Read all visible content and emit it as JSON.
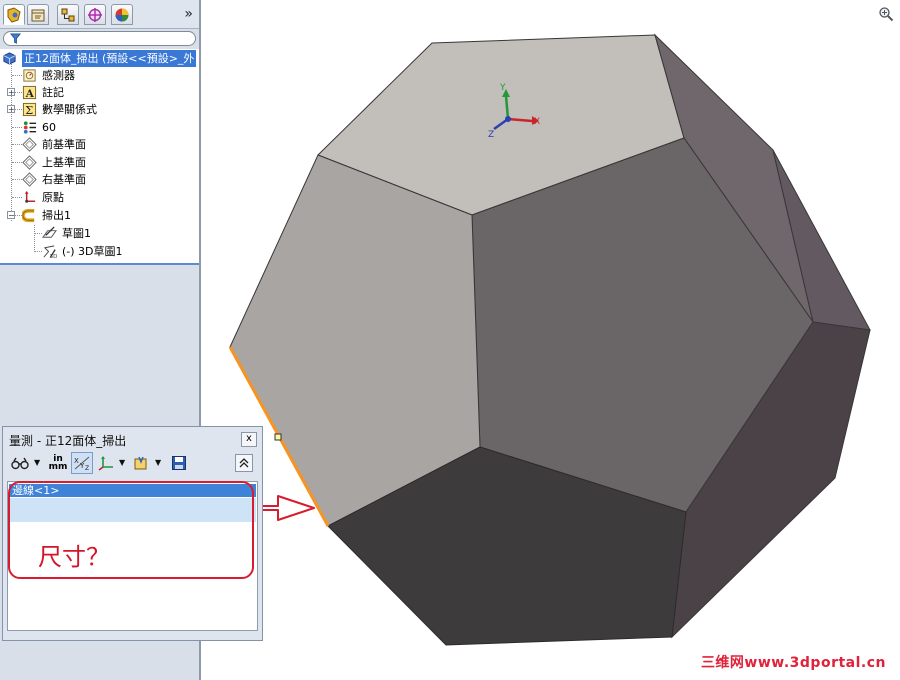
{
  "feature_tree": {
    "root_label": "正12面体_掃出 (預設<<預設>_外",
    "items": [
      {
        "label": "感測器",
        "icon": "sensor-icon"
      },
      {
        "label": "註記",
        "icon": "annotation-icon"
      },
      {
        "label": "數學關係式",
        "icon": "equation-icon"
      },
      {
        "label": "60",
        "icon": "design-table-icon"
      },
      {
        "label": "前基準面",
        "icon": "plane-icon"
      },
      {
        "label": "上基準面",
        "icon": "plane-icon"
      },
      {
        "label": "右基準面",
        "icon": "plane-icon"
      },
      {
        "label": "原點",
        "icon": "origin-icon"
      },
      {
        "label": "掃出1",
        "icon": "sweep-icon"
      },
      {
        "label": "草圖1",
        "icon": "sketch-icon"
      },
      {
        "label": "(-) 3D草圖1",
        "icon": "3d-sketch-icon"
      }
    ]
  },
  "measure_dialog": {
    "title": "量測 - 正12面体_掃出",
    "close_label": "x",
    "units_label_top": "in",
    "units_label_bottom": "mm",
    "selection_item": "邊線<1>"
  },
  "annotation": {
    "text": "尺寸？"
  },
  "triad": {
    "x_label": "X",
    "y_label": "Y",
    "z_label": "Z"
  },
  "toolbar": {
    "overflow_label": "»"
  },
  "watermark": "三维网www.3dportal.cn",
  "colors": {
    "selection_blue": "#3f83d8",
    "annotation_red": "#d81c2e",
    "edge_highlight": "#f7931e"
  }
}
